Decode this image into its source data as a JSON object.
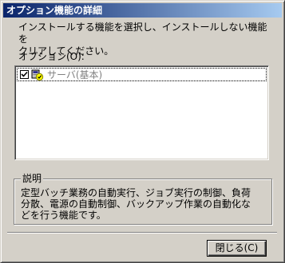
{
  "window": {
    "title": "オプション機能の詳細"
  },
  "intro_text": "インストールする機能を選択し、インストールしない機能を\nクリアしてください。",
  "options": {
    "label": "オプション(O):",
    "items": [
      {
        "label": "サーバ(基本)",
        "checked": true,
        "icon": "server-component-icon"
      }
    ]
  },
  "description": {
    "group_label": "説明",
    "text": "定型バッチ業務の自動実行、ジョブ実行の制御、負荷\n分散、電源の自動制御、バックアップ作業の自動化な\nどを行う機能です。"
  },
  "buttons": {
    "close_label": "閉じる(C)"
  }
}
